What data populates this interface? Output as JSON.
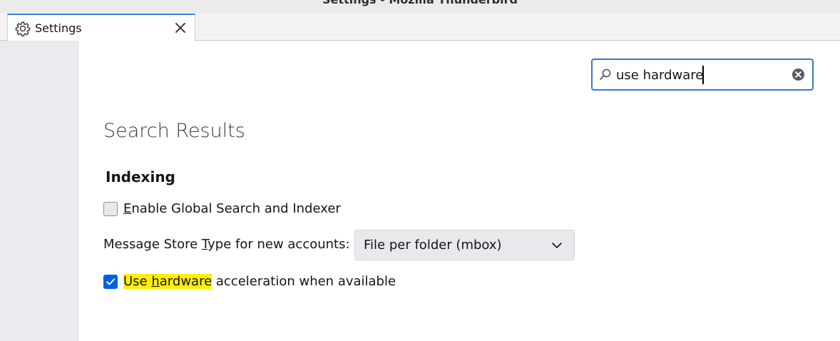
{
  "window": {
    "title": "Settings - Mozilla Thunderbird"
  },
  "tab": {
    "label": "Settings",
    "icon": "gear-icon",
    "close_icon": "close-icon"
  },
  "search": {
    "value": "use hardware",
    "icon": "search-icon",
    "clear_icon": "clear-icon"
  },
  "main": {
    "heading": "Search Results",
    "section": {
      "title": "Indexing",
      "global_search": {
        "access_key": "E",
        "rest": "nable Global Search and Indexer",
        "checked": false
      },
      "message_store": {
        "prefix": "Message Store ",
        "access_key": "T",
        "suffix": "ype for new accounts:",
        "selected": "File per folder (mbox)"
      },
      "hardware_accel": {
        "hl_before": "Use ",
        "hl_key": "h",
        "hl_after": "ardware",
        "rest": " acceleration when available",
        "checked": true
      }
    }
  },
  "colors": {
    "accent": "#0061e0",
    "highlight": "#ffef00",
    "focus_border": "#3a78c4"
  }
}
